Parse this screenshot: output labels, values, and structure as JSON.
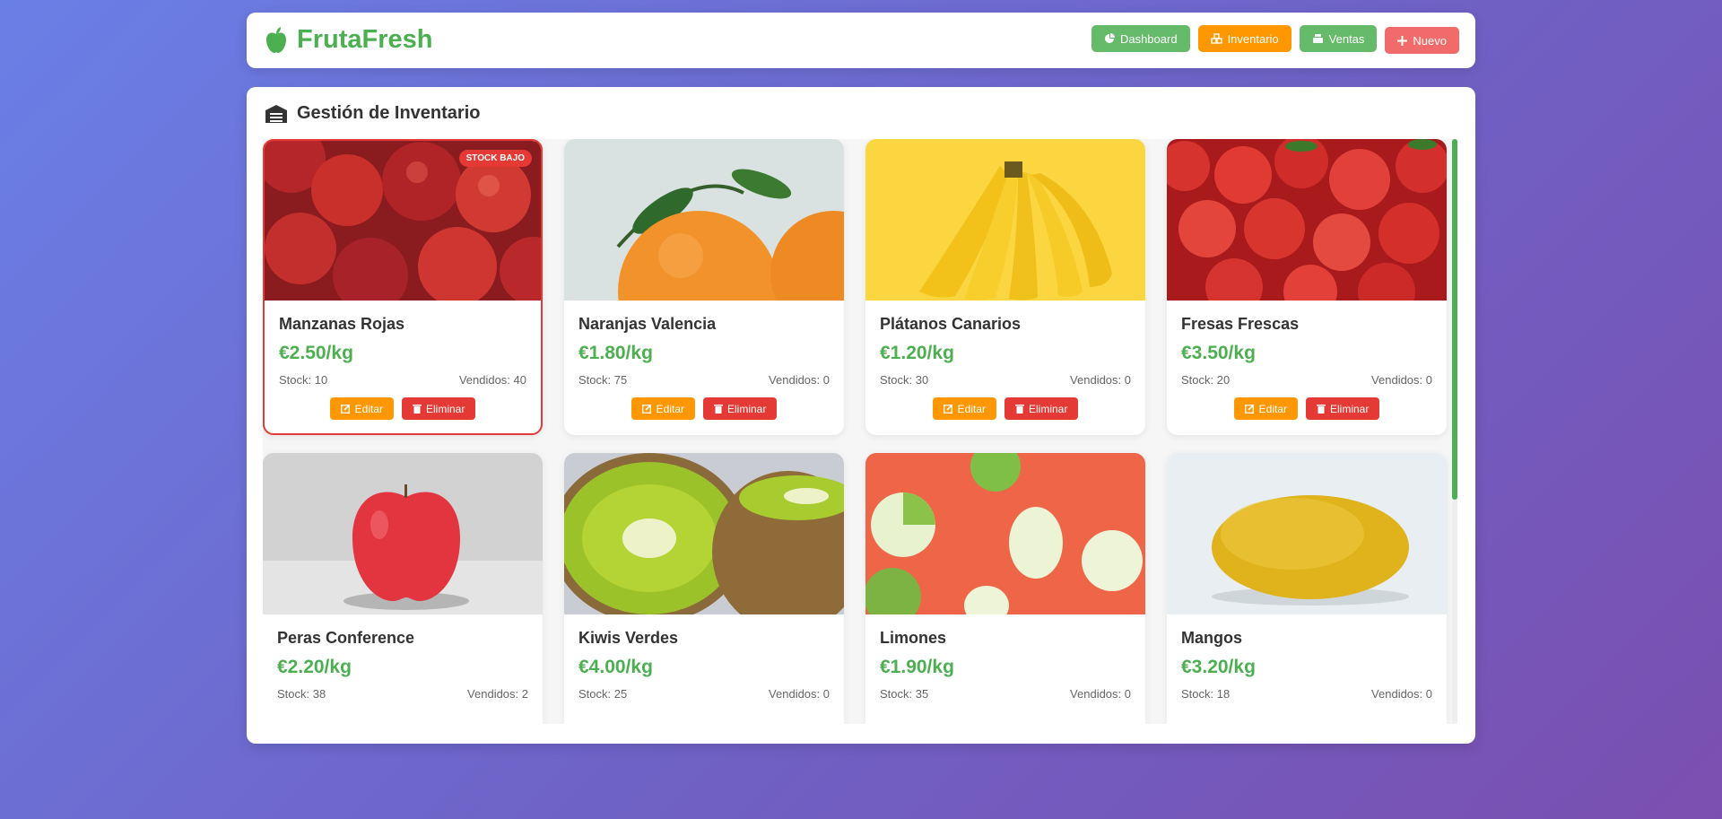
{
  "app": {
    "name": "FrutaFresh",
    "icon": "apple-icon"
  },
  "nav": {
    "dashboard": {
      "label": "Dashboard",
      "icon": "chart-pie-icon"
    },
    "inventario": {
      "label": "Inventario",
      "icon": "boxes-icon"
    },
    "ventas": {
      "label": "Ventas",
      "icon": "cash-register-icon"
    },
    "nuevo": {
      "label": "Nuevo",
      "icon": "plus-icon"
    }
  },
  "section": {
    "title": "Gestión de Inventario",
    "icon": "warehouse-icon"
  },
  "labels": {
    "edit": "Editar",
    "delete": "Eliminar"
  },
  "products": [
    {
      "name": "Manzanas Rojas",
      "price": "€2.50/kg",
      "stock": "Stock: 10",
      "sold": "Vendidos: 40",
      "badge": "STOCK BAJO",
      "image": "red-apples"
    },
    {
      "name": "Naranjas Valencia",
      "price": "€1.80/kg",
      "stock": "Stock: 75",
      "sold": "Vendidos: 0",
      "image": "oranges"
    },
    {
      "name": "Plátanos Canarios",
      "price": "€1.20/kg",
      "stock": "Stock: 30",
      "sold": "Vendidos: 0",
      "image": "bananas"
    },
    {
      "name": "Fresas Frescas",
      "price": "€3.50/kg",
      "stock": "Stock: 20",
      "sold": "Vendidos: 0",
      "image": "strawberries"
    },
    {
      "name": "Peras Conference",
      "price": "€2.20/kg",
      "stock": "Stock: 38",
      "sold": "Vendidos: 2",
      "image": "single-apple"
    },
    {
      "name": "Kiwis Verdes",
      "price": "€4.00/kg",
      "stock": "Stock: 25",
      "sold": "Vendidos: 0",
      "image": "kiwis"
    },
    {
      "name": "Limones",
      "price": "€1.90/kg",
      "stock": "Stock: 35",
      "sold": "Vendidos: 0",
      "image": "green-apples"
    },
    {
      "name": "Mangos",
      "price": "€3.20/kg",
      "stock": "Stock: 18",
      "sold": "Vendidos: 0",
      "image": "mango"
    }
  ],
  "colors": {
    "brand": "#4caf50",
    "warning": "#ff9800",
    "danger": "#e53935"
  }
}
